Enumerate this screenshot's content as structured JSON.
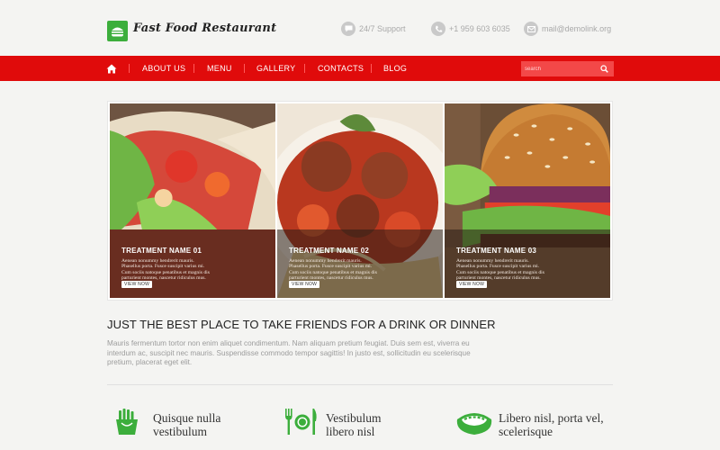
{
  "header": {
    "logo_text": "Fast Food Restaurant",
    "support_label": "24/7 Support",
    "phone_label": "+1 959 603 6035",
    "email_label": "mail@demolink.org"
  },
  "nav": {
    "items": [
      {
        "label": "ABOUT US"
      },
      {
        "label": "MENU"
      },
      {
        "label": "GALLERY"
      },
      {
        "label": "CONTACTS"
      },
      {
        "label": "BLOG"
      }
    ],
    "search_placeholder": "search"
  },
  "gallery": {
    "cards": [
      {
        "title": "TREATMENT NAME 01",
        "text": "Aenean nonummy hendrerit mauris. Phasellus porta. Fusce suscipit varius mi. Cum sociis natoque penatibus et magnis dis parturient montes, nascetur ridiculus mus.",
        "button": "VIEW NOW"
      },
      {
        "title": "TREATMENT NAME 02",
        "text": "Aenean nonummy hendrerit mauris. Phasellus porta. Fusce suscipit varius mi. Cum sociis natoque penatibus et magnis dis parturient montes, nascetur ridiculus mus.",
        "button": "VIEW NOW"
      },
      {
        "title": "TREATMENT NAME 03",
        "text": "Aenean nonummy hendrerit mauris. Phasellus porta. Fusce suscipit varius mi. Cum sociis natoque penatibus et magnis dis parturient montes, nascetur ridiculus mus.",
        "button": "VIEW NOW"
      }
    ]
  },
  "intro": {
    "headline": "JUST THE BEST PLACE TO TAKE FRIENDS FOR A DRINK OR DINNER",
    "paragraph": "Mauris fermentum tortor non enim aliquet condimentum. Nam aliquam pretium feugiat. Duis sem est, viverra eu interdum ac, suscipit nec mauris. Suspendisse commodo tempor sagittis! In justo est, sollicitudin eu scelerisque pretium, placerat eget elit."
  },
  "features": [
    {
      "line1": "Quisque nulla",
      "line2": "vestibulum",
      "icon": "fries-icon"
    },
    {
      "line1": "Vestibulum",
      "line2": "libero nisl",
      "icon": "cutlery-icon"
    },
    {
      "line1": "Libero nisl, porta vel,",
      "line2": "scelerisque",
      "icon": "hotdog-icon"
    }
  ],
  "colors": {
    "brand_red": "#e00b0b",
    "brand_green": "#3cae3c",
    "background": "#f4f4f2"
  }
}
